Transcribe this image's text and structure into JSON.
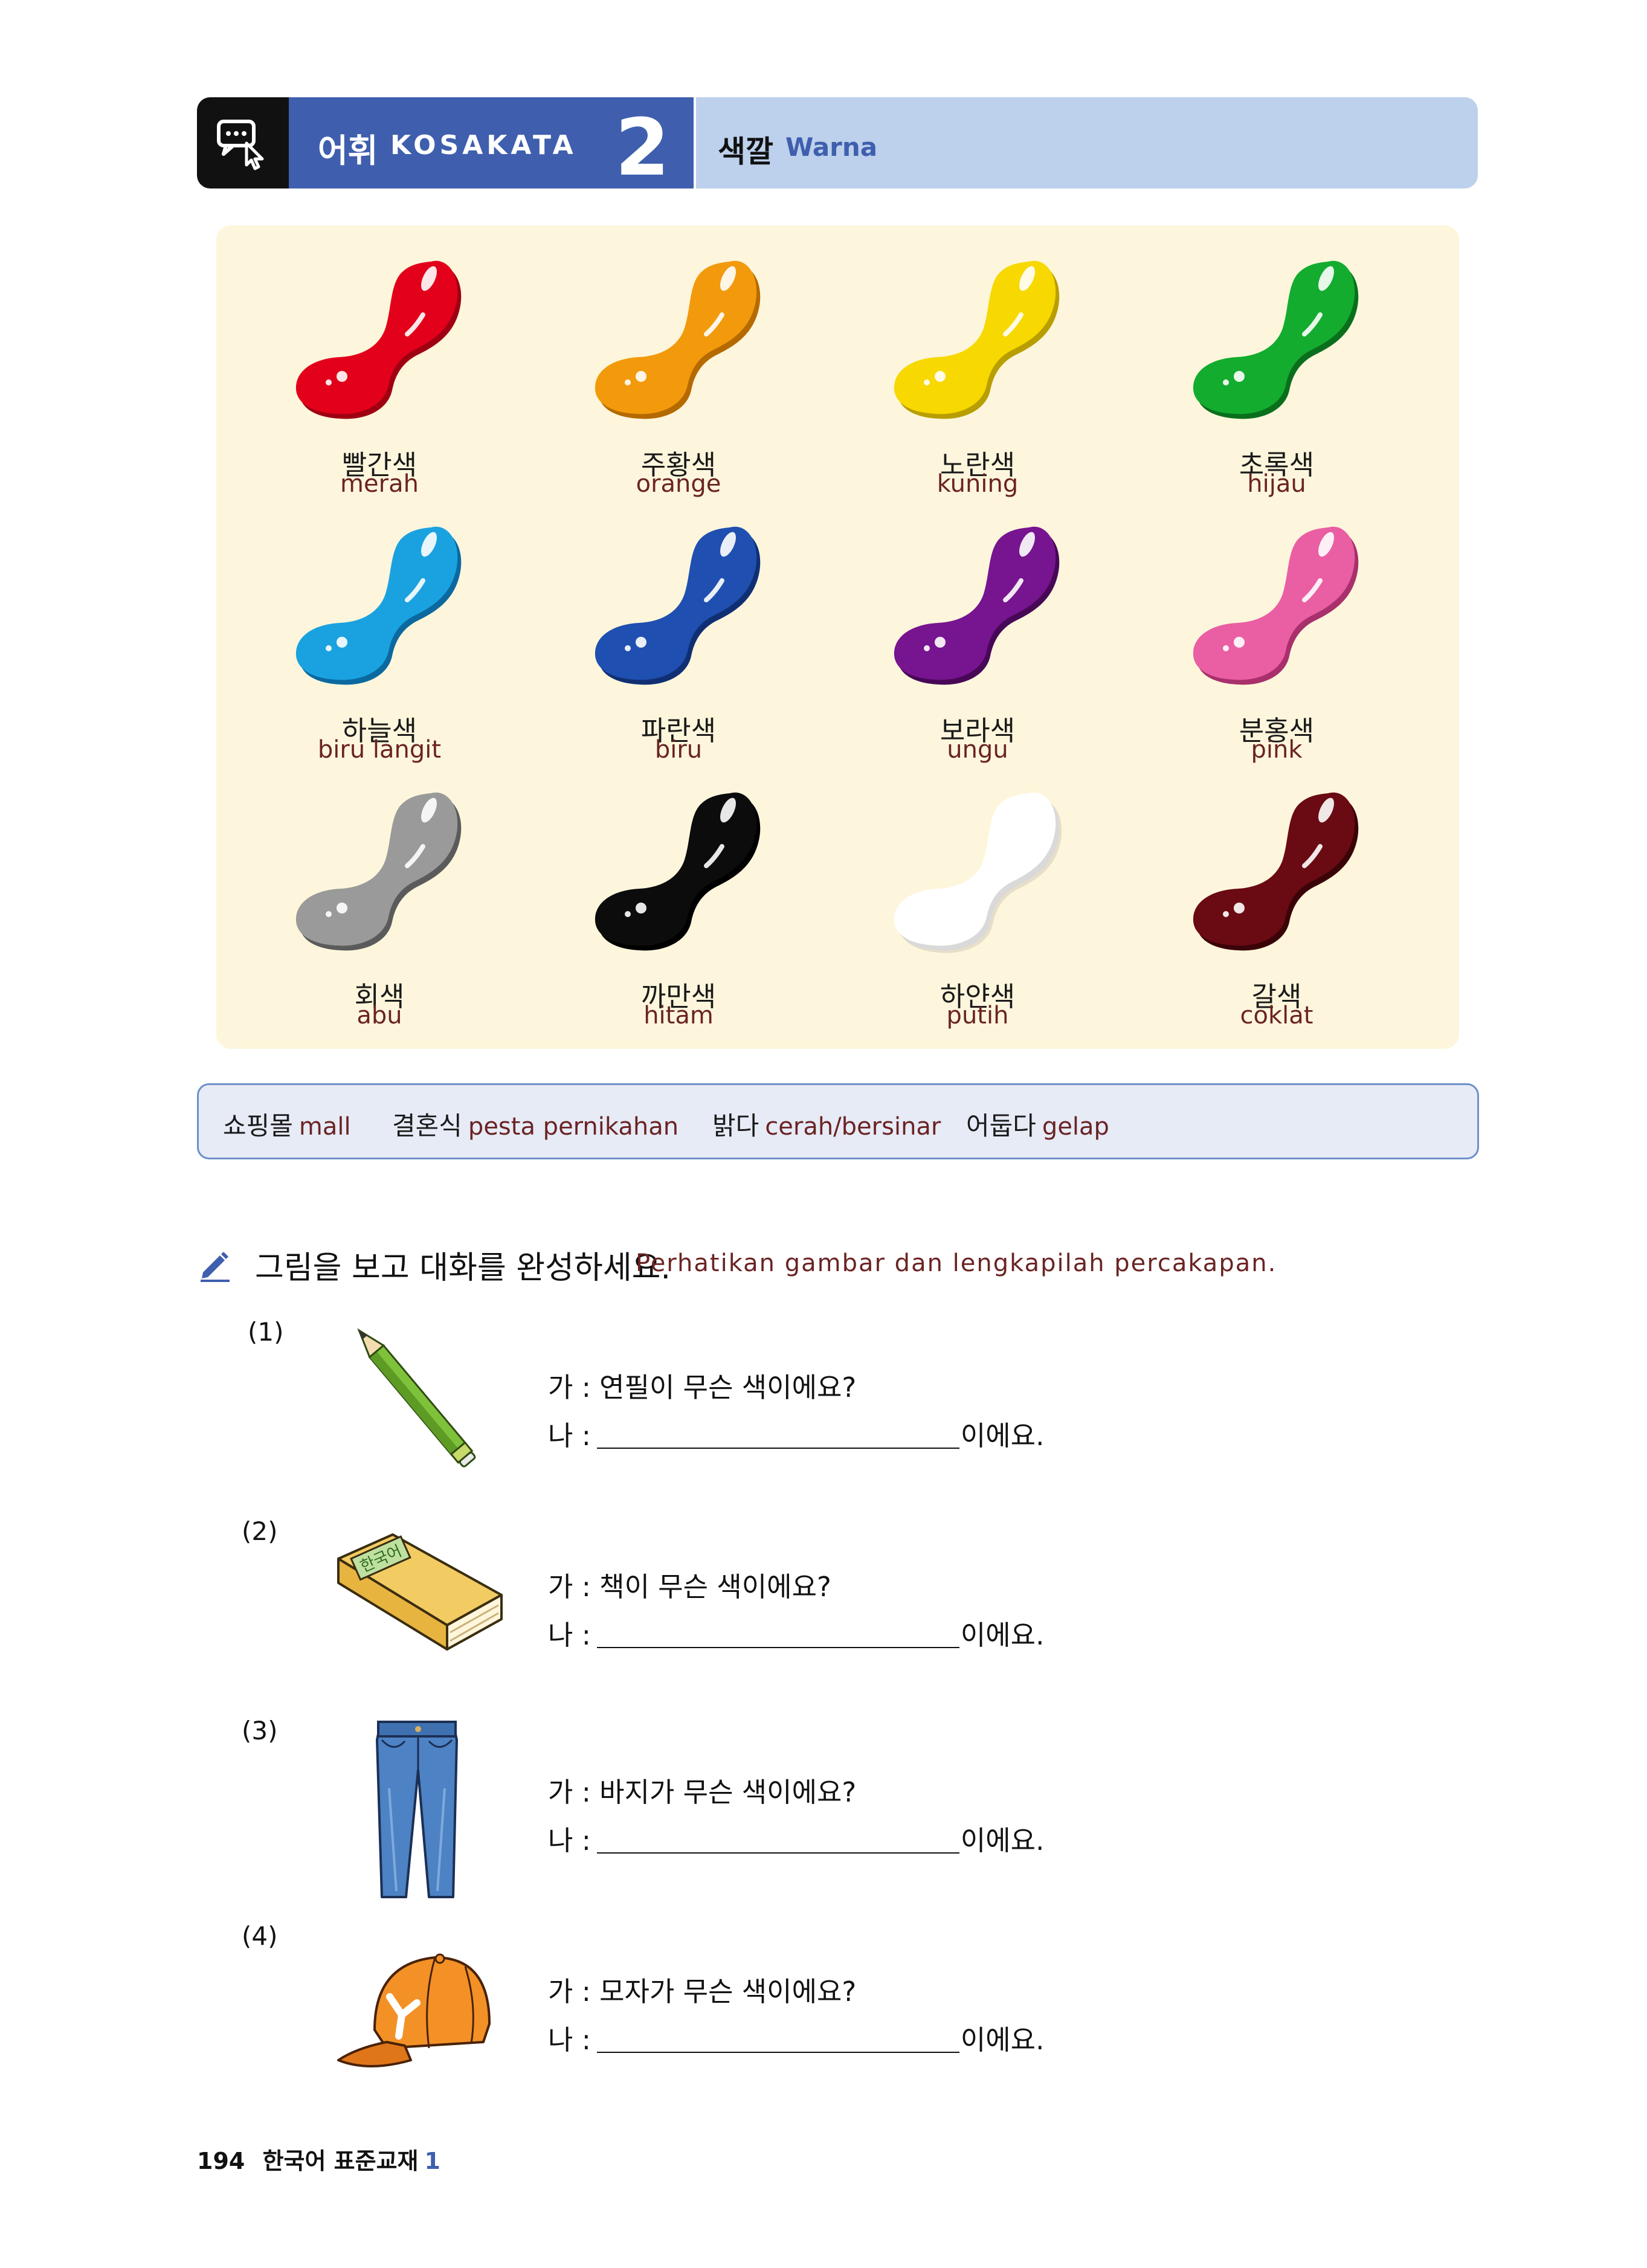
{
  "header": {
    "section_ko": "어휘",
    "section_id": "KOSAKATA",
    "number": "2",
    "topic_ko": "색깔",
    "topic_id": "Warna"
  },
  "colors": [
    {
      "ko": "빨간색",
      "id": "merah",
      "color": "#e2001a",
      "shade": "#9e0012"
    },
    {
      "ko": "주황색",
      "id": "orange",
      "color": "#f29a0c",
      "shade": "#b56a00"
    },
    {
      "ko": "노란색",
      "id": "kuning",
      "color": "#f7d800",
      "shade": "#b89e00"
    },
    {
      "ko": "초록색",
      "id": "hijau",
      "color": "#13ac2f",
      "shade": "#0a6f1c"
    },
    {
      "ko": "하늘색",
      "id": "biru langit",
      "color": "#1aa2e0",
      "shade": "#0b69a0"
    },
    {
      "ko": "파란색",
      "id": "biru",
      "color": "#1f4fb0",
      "shade": "#102f73"
    },
    {
      "ko": "보라색",
      "id": "ungu",
      "color": "#77148f",
      "shade": "#470856"
    },
    {
      "ko": "분홍색",
      "id": "pink",
      "color": "#ea5ea3",
      "shade": "#a8306c"
    },
    {
      "ko": "회색",
      "id": "abu",
      "color": "#9a9a9a",
      "shade": "#5b5b5b"
    },
    {
      "ko": "까만색",
      "id": "hitam",
      "color": "#0c0c0c",
      "shade": "#000000"
    },
    {
      "ko": "하얀색",
      "id": "putih",
      "color": "#ffffff",
      "shade": "#d9d9d9"
    },
    {
      "ko": "갈색",
      "id": "coklat",
      "color": "#6a0a12",
      "shade": "#3a0308"
    }
  ],
  "words": [
    {
      "ko": "쇼핑몰",
      "id": "mall"
    },
    {
      "ko": "결혼식",
      "id": "pesta pernikahan"
    },
    {
      "ko": "밝다",
      "id": "cerah/bersinar"
    },
    {
      "ko": "어둡다",
      "id": "gelap"
    }
  ],
  "instruction": {
    "ko": "그림을 보고 대화를 완성하세요.",
    "id": "Perhatikan gambar dan lengkapilah percakapan."
  },
  "book_label": "한국어",
  "exercises": [
    {
      "num": "(1)",
      "q": "가 : 연필이 무슨 색이에요?",
      "a_prefix": "나 :",
      "a_suffix": "이에요.",
      "icon": "pencil-icon"
    },
    {
      "num": "(2)",
      "q": "가 : 책이 무슨 색이에요?",
      "a_prefix": "나 :",
      "a_suffix": "이에요.",
      "icon": "book-icon"
    },
    {
      "num": "(3)",
      "q": "가 : 바지가 무슨 색이에요?",
      "a_prefix": "나 :",
      "a_suffix": "이에요.",
      "icon": "jeans-icon"
    },
    {
      "num": "(4)",
      "q": "가 : 모자가 무슨 색이에요?",
      "a_prefix": "나 :",
      "a_suffix": "이에요.",
      "icon": "cap-icon"
    }
  ],
  "footer": {
    "page": "194",
    "book": "한국어 표준교재",
    "volume": "1"
  }
}
